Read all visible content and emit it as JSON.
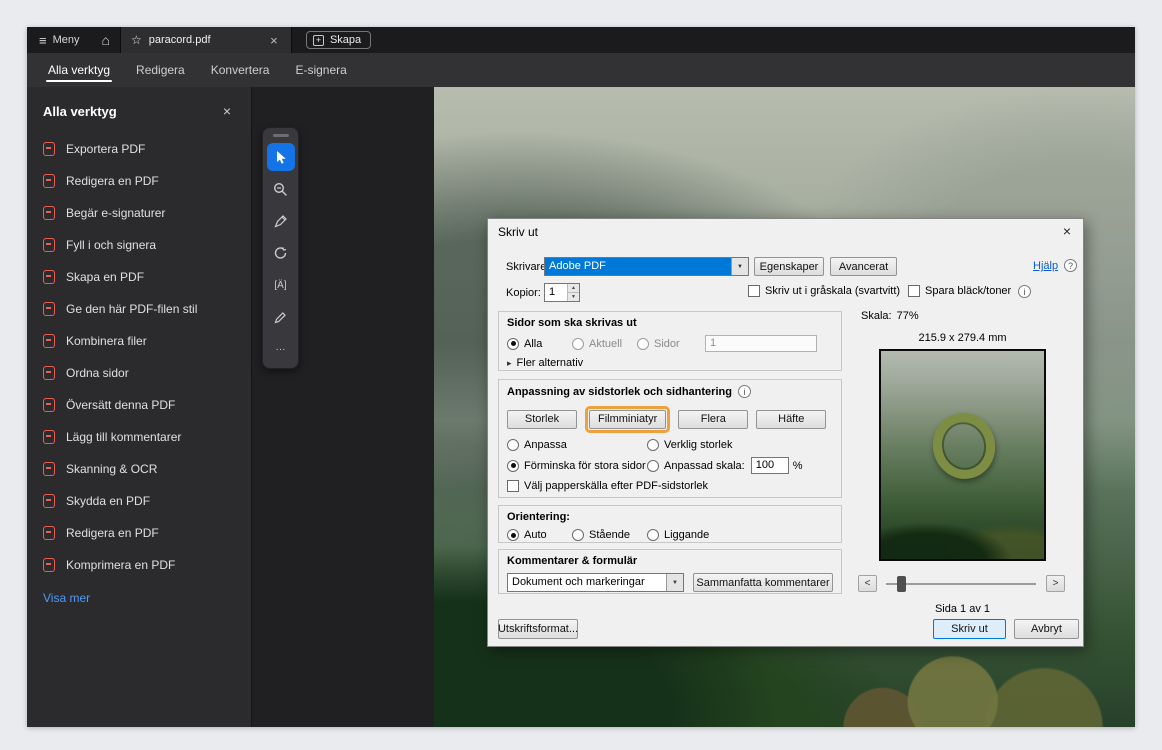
{
  "topbar": {
    "menu_label": "Meny",
    "doc_tab": "paracord.pdf",
    "create_label": "Skapa"
  },
  "nav": {
    "tabs": [
      {
        "label": "Alla verktyg"
      },
      {
        "label": "Redigera"
      },
      {
        "label": "Konvertera"
      },
      {
        "label": "E-signera"
      }
    ]
  },
  "sidebar": {
    "title": "Alla verktyg",
    "items": [
      {
        "label": "Exportera PDF"
      },
      {
        "label": "Redigera en PDF"
      },
      {
        "label": "Begär e-signaturer"
      },
      {
        "label": "Fyll i och signera"
      },
      {
        "label": "Skapa en PDF"
      },
      {
        "label": "Ge den här PDF-filen stil"
      },
      {
        "label": "Kombinera filer"
      },
      {
        "label": "Ordna sidor"
      },
      {
        "label": "Översätt denna PDF"
      },
      {
        "label": "Lägg till kommentarer"
      },
      {
        "label": "Skanning & OCR"
      },
      {
        "label": "Skydda en PDF"
      },
      {
        "label": "Redigera en PDF"
      },
      {
        "label": "Komprimera en PDF"
      }
    ],
    "show_more": "Visa mer"
  },
  "dialog": {
    "title": "Skriv ut",
    "printer_label": "Skrivare:",
    "printer_value": "Adobe PDF",
    "properties": "Egenskaper",
    "advanced": "Avancerat",
    "help": "Hjälp",
    "copies_label": "Kopior:",
    "copies_value": "1",
    "grayscale": "Skriv ut i gråskala (svartvitt)",
    "save_ink": "Spara bläck/toner",
    "pages": {
      "title": "Sidor som ska skrivas ut",
      "all": "Alla",
      "current": "Aktuell",
      "range": "Sidor",
      "range_value": "1",
      "more": "Fler alternativ"
    },
    "sizing": {
      "title": "Anpassning av sidstorlek och sidhantering",
      "size_btn": "Storlek",
      "poster_btn": "Filmminiatyr",
      "multiple_btn": "Flera",
      "booklet_btn": "Häfte",
      "fit": "Anpassa",
      "actual": "Verklig storlek",
      "shrink": "Förminska för stora sidor",
      "custom": "Anpassad skala:",
      "custom_value": "100",
      "percent": "%",
      "paper_source": "Välj papperskälla efter PDF-sidstorlek"
    },
    "orientation": {
      "title": "Orientering:",
      "auto": "Auto",
      "portrait": "Stående",
      "landscape": "Liggande"
    },
    "comments": {
      "title": "Kommentarer & formulär",
      "dropdown_value": "Dokument och markeringar",
      "summarize_btn": "Sammanfatta kommentarer"
    },
    "preview": {
      "scale_label": "Skala:",
      "scale_value": "77%",
      "size_text": "215.9 x 279.4 mm",
      "page_text": "Sida 1 av 1"
    },
    "footer": {
      "page_setup": "Utskriftsformat...",
      "print": "Skriv ut",
      "cancel": "Avbryt"
    }
  },
  "icons": {
    "menu": "≡",
    "home": "⌂",
    "star": "☆",
    "close": "×",
    "plus": "+",
    "expand": "▸",
    "dropdown": "▼",
    "spin_up": "▲",
    "spin_down": "▼",
    "info": "i",
    "help": "?",
    "prev": "<",
    "next": ">",
    "more_tools": "···",
    "text_tool": "[Ä]"
  },
  "colors": {
    "selection_blue": "#0078d7",
    "callout_orange": "#EDA03C",
    "accent_blue": "#1473e6",
    "link_blue": "#0B5BD3",
    "sidebar_link_blue": "#4F9BF5",
    "sidebar_icon_red": "#E8604F"
  }
}
